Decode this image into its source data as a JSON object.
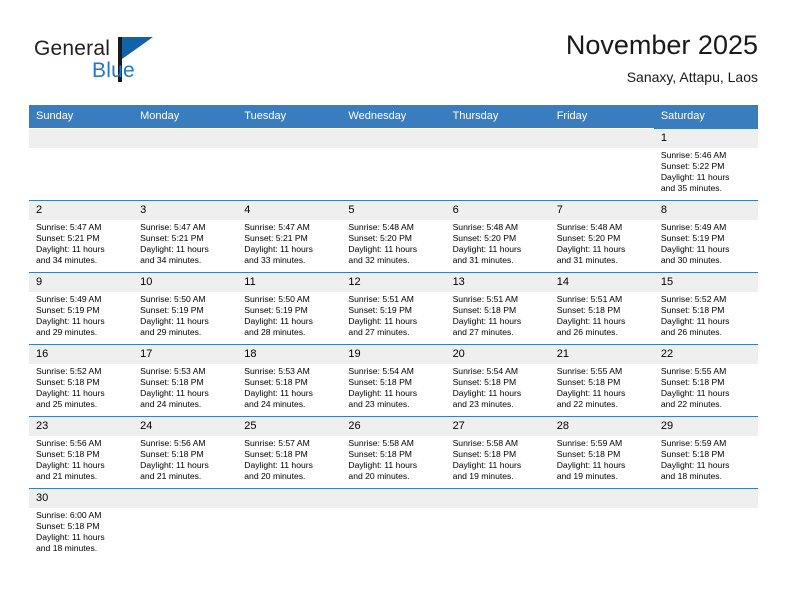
{
  "brand": {
    "name_part1": "General",
    "name_part2": "Blue"
  },
  "header": {
    "month_title": "November 2025",
    "location": "Sanaxy, Attapu, Laos"
  },
  "weekday_headers": [
    "Sunday",
    "Monday",
    "Tuesday",
    "Wednesday",
    "Thursday",
    "Friday",
    "Saturday"
  ],
  "colors": {
    "header_blue": "#3a7dbf",
    "brand_blue": "#2277c8",
    "daynum_band": "#efefef",
    "text": "#000000"
  },
  "weeks": [
    [
      {
        "day": "",
        "sunrise": "",
        "sunset": "",
        "daylight_line1": "",
        "daylight_line2": "",
        "blank": true
      },
      {
        "day": "",
        "sunrise": "",
        "sunset": "",
        "daylight_line1": "",
        "daylight_line2": "",
        "blank": true
      },
      {
        "day": "",
        "sunrise": "",
        "sunset": "",
        "daylight_line1": "",
        "daylight_line2": "",
        "blank": true
      },
      {
        "day": "",
        "sunrise": "",
        "sunset": "",
        "daylight_line1": "",
        "daylight_line2": "",
        "blank": true
      },
      {
        "day": "",
        "sunrise": "",
        "sunset": "",
        "daylight_line1": "",
        "daylight_line2": "",
        "blank": true
      },
      {
        "day": "",
        "sunrise": "",
        "sunset": "",
        "daylight_line1": "",
        "daylight_line2": "",
        "blank": true
      },
      {
        "day": "1",
        "sunrise": "Sunrise: 5:46 AM",
        "sunset": "Sunset: 5:22 PM",
        "daylight_line1": "Daylight: 11 hours",
        "daylight_line2": "and 35 minutes.",
        "blank": false
      }
    ],
    [
      {
        "day": "2",
        "sunrise": "Sunrise: 5:47 AM",
        "sunset": "Sunset: 5:21 PM",
        "daylight_line1": "Daylight: 11 hours",
        "daylight_line2": "and 34 minutes.",
        "blank": false
      },
      {
        "day": "3",
        "sunrise": "Sunrise: 5:47 AM",
        "sunset": "Sunset: 5:21 PM",
        "daylight_line1": "Daylight: 11 hours",
        "daylight_line2": "and 34 minutes.",
        "blank": false
      },
      {
        "day": "4",
        "sunrise": "Sunrise: 5:47 AM",
        "sunset": "Sunset: 5:21 PM",
        "daylight_line1": "Daylight: 11 hours",
        "daylight_line2": "and 33 minutes.",
        "blank": false
      },
      {
        "day": "5",
        "sunrise": "Sunrise: 5:48 AM",
        "sunset": "Sunset: 5:20 PM",
        "daylight_line1": "Daylight: 11 hours",
        "daylight_line2": "and 32 minutes.",
        "blank": false
      },
      {
        "day": "6",
        "sunrise": "Sunrise: 5:48 AM",
        "sunset": "Sunset: 5:20 PM",
        "daylight_line1": "Daylight: 11 hours",
        "daylight_line2": "and 31 minutes.",
        "blank": false
      },
      {
        "day": "7",
        "sunrise": "Sunrise: 5:48 AM",
        "sunset": "Sunset: 5:20 PM",
        "daylight_line1": "Daylight: 11 hours",
        "daylight_line2": "and 31 minutes.",
        "blank": false
      },
      {
        "day": "8",
        "sunrise": "Sunrise: 5:49 AM",
        "sunset": "Sunset: 5:19 PM",
        "daylight_line1": "Daylight: 11 hours",
        "daylight_line2": "and 30 minutes.",
        "blank": false
      }
    ],
    [
      {
        "day": "9",
        "sunrise": "Sunrise: 5:49 AM",
        "sunset": "Sunset: 5:19 PM",
        "daylight_line1": "Daylight: 11 hours",
        "daylight_line2": "and 29 minutes.",
        "blank": false
      },
      {
        "day": "10",
        "sunrise": "Sunrise: 5:50 AM",
        "sunset": "Sunset: 5:19 PM",
        "daylight_line1": "Daylight: 11 hours",
        "daylight_line2": "and 29 minutes.",
        "blank": false
      },
      {
        "day": "11",
        "sunrise": "Sunrise: 5:50 AM",
        "sunset": "Sunset: 5:19 PM",
        "daylight_line1": "Daylight: 11 hours",
        "daylight_line2": "and 28 minutes.",
        "blank": false
      },
      {
        "day": "12",
        "sunrise": "Sunrise: 5:51 AM",
        "sunset": "Sunset: 5:19 PM",
        "daylight_line1": "Daylight: 11 hours",
        "daylight_line2": "and 27 minutes.",
        "blank": false
      },
      {
        "day": "13",
        "sunrise": "Sunrise: 5:51 AM",
        "sunset": "Sunset: 5:18 PM",
        "daylight_line1": "Daylight: 11 hours",
        "daylight_line2": "and 27 minutes.",
        "blank": false
      },
      {
        "day": "14",
        "sunrise": "Sunrise: 5:51 AM",
        "sunset": "Sunset: 5:18 PM",
        "daylight_line1": "Daylight: 11 hours",
        "daylight_line2": "and 26 minutes.",
        "blank": false
      },
      {
        "day": "15",
        "sunrise": "Sunrise: 5:52 AM",
        "sunset": "Sunset: 5:18 PM",
        "daylight_line1": "Daylight: 11 hours",
        "daylight_line2": "and 26 minutes.",
        "blank": false
      }
    ],
    [
      {
        "day": "16",
        "sunrise": "Sunrise: 5:52 AM",
        "sunset": "Sunset: 5:18 PM",
        "daylight_line1": "Daylight: 11 hours",
        "daylight_line2": "and 25 minutes.",
        "blank": false
      },
      {
        "day": "17",
        "sunrise": "Sunrise: 5:53 AM",
        "sunset": "Sunset: 5:18 PM",
        "daylight_line1": "Daylight: 11 hours",
        "daylight_line2": "and 24 minutes.",
        "blank": false
      },
      {
        "day": "18",
        "sunrise": "Sunrise: 5:53 AM",
        "sunset": "Sunset: 5:18 PM",
        "daylight_line1": "Daylight: 11 hours",
        "daylight_line2": "and 24 minutes.",
        "blank": false
      },
      {
        "day": "19",
        "sunrise": "Sunrise: 5:54 AM",
        "sunset": "Sunset: 5:18 PM",
        "daylight_line1": "Daylight: 11 hours",
        "daylight_line2": "and 23 minutes.",
        "blank": false
      },
      {
        "day": "20",
        "sunrise": "Sunrise: 5:54 AM",
        "sunset": "Sunset: 5:18 PM",
        "daylight_line1": "Daylight: 11 hours",
        "daylight_line2": "and 23 minutes.",
        "blank": false
      },
      {
        "day": "21",
        "sunrise": "Sunrise: 5:55 AM",
        "sunset": "Sunset: 5:18 PM",
        "daylight_line1": "Daylight: 11 hours",
        "daylight_line2": "and 22 minutes.",
        "blank": false
      },
      {
        "day": "22",
        "sunrise": "Sunrise: 5:55 AM",
        "sunset": "Sunset: 5:18 PM",
        "daylight_line1": "Daylight: 11 hours",
        "daylight_line2": "and 22 minutes.",
        "blank": false
      }
    ],
    [
      {
        "day": "23",
        "sunrise": "Sunrise: 5:56 AM",
        "sunset": "Sunset: 5:18 PM",
        "daylight_line1": "Daylight: 11 hours",
        "daylight_line2": "and 21 minutes.",
        "blank": false
      },
      {
        "day": "24",
        "sunrise": "Sunrise: 5:56 AM",
        "sunset": "Sunset: 5:18 PM",
        "daylight_line1": "Daylight: 11 hours",
        "daylight_line2": "and 21 minutes.",
        "blank": false
      },
      {
        "day": "25",
        "sunrise": "Sunrise: 5:57 AM",
        "sunset": "Sunset: 5:18 PM",
        "daylight_line1": "Daylight: 11 hours",
        "daylight_line2": "and 20 minutes.",
        "blank": false
      },
      {
        "day": "26",
        "sunrise": "Sunrise: 5:58 AM",
        "sunset": "Sunset: 5:18 PM",
        "daylight_line1": "Daylight: 11 hours",
        "daylight_line2": "and 20 minutes.",
        "blank": false
      },
      {
        "day": "27",
        "sunrise": "Sunrise: 5:58 AM",
        "sunset": "Sunset: 5:18 PM",
        "daylight_line1": "Daylight: 11 hours",
        "daylight_line2": "and 19 minutes.",
        "blank": false
      },
      {
        "day": "28",
        "sunrise": "Sunrise: 5:59 AM",
        "sunset": "Sunset: 5:18 PM",
        "daylight_line1": "Daylight: 11 hours",
        "daylight_line2": "and 19 minutes.",
        "blank": false
      },
      {
        "day": "29",
        "sunrise": "Sunrise: 5:59 AM",
        "sunset": "Sunset: 5:18 PM",
        "daylight_line1": "Daylight: 11 hours",
        "daylight_line2": "and 18 minutes.",
        "blank": false
      }
    ],
    [
      {
        "day": "30",
        "sunrise": "Sunrise: 6:00 AM",
        "sunset": "Sunset: 5:18 PM",
        "daylight_line1": "Daylight: 11 hours",
        "daylight_line2": "and 18 minutes.",
        "blank": false
      },
      {
        "day": "",
        "sunrise": "",
        "sunset": "",
        "daylight_line1": "",
        "daylight_line2": "",
        "blank": true
      },
      {
        "day": "",
        "sunrise": "",
        "sunset": "",
        "daylight_line1": "",
        "daylight_line2": "",
        "blank": true
      },
      {
        "day": "",
        "sunrise": "",
        "sunset": "",
        "daylight_line1": "",
        "daylight_line2": "",
        "blank": true
      },
      {
        "day": "",
        "sunrise": "",
        "sunset": "",
        "daylight_line1": "",
        "daylight_line2": "",
        "blank": true
      },
      {
        "day": "",
        "sunrise": "",
        "sunset": "",
        "daylight_line1": "",
        "daylight_line2": "",
        "blank": true
      },
      {
        "day": "",
        "sunrise": "",
        "sunset": "",
        "daylight_line1": "",
        "daylight_line2": "",
        "blank": true
      }
    ]
  ]
}
